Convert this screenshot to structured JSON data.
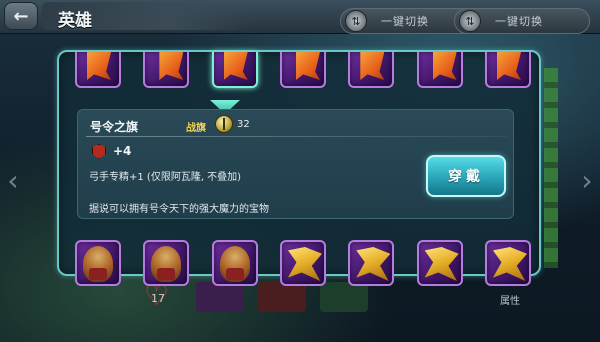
{
  "header": {
    "title": "英雄",
    "switch_buttons": [
      {
        "label": "一键切换"
      },
      {
        "label": "一键切换"
      }
    ]
  },
  "inventory": {
    "top_row": [
      {
        "type": "flag"
      },
      {
        "type": "flag"
      },
      {
        "type": "flag",
        "selected": true
      },
      {
        "type": "flag"
      },
      {
        "type": "flag"
      },
      {
        "type": "flag"
      },
      {
        "type": "flag"
      }
    ],
    "bottom_row": [
      {
        "type": "warrior"
      },
      {
        "type": "warrior"
      },
      {
        "type": "warrior"
      },
      {
        "type": "wing"
      },
      {
        "type": "wing"
      },
      {
        "type": "wing"
      },
      {
        "type": "wing"
      }
    ]
  },
  "selected_item": {
    "name": "号令之旗",
    "category": "战旗",
    "price": "32",
    "stat": "+4",
    "effect": "弓手专精+1 (仅限阿瓦隆, 不叠加)",
    "description": "据说可以拥有号令天下的强大魔力的宝物",
    "equip_label": "穿戴"
  },
  "background": {
    "heart_count": "17",
    "attribute_label": "属性"
  },
  "colors": {
    "panel_border": "#69c8c6",
    "slot_purple": "#6f2fa0",
    "equip_button": "#29a5b8",
    "category_gold": "#f5d04a"
  }
}
